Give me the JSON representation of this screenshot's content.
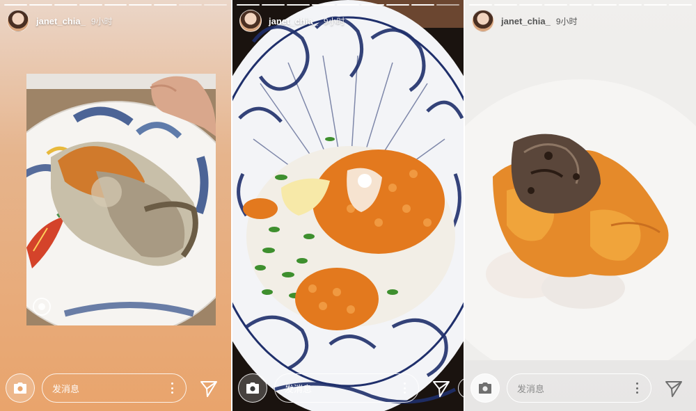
{
  "stories": [
    {
      "username": "janet_chia_",
      "time": "9小时",
      "message_placeholder": "发消息",
      "photo_icon": "camera-icon",
      "photo_label": "grilled oyster on patterned plate"
    },
    {
      "username": "janet_chia_",
      "time": "9小时",
      "message_placeholder": "发消息",
      "photo_icon": "camera-icon",
      "photo_label": "tobiko with scallion and grated garlic"
    },
    {
      "username": "janet_chia_",
      "time": "9小时",
      "message_placeholder": "发消息",
      "photo_icon": "camera-icon",
      "photo_label": "uni with black truffle on scallop"
    }
  ],
  "colors": {
    "panel1_bg_top": "#ebd6c8",
    "panel1_bg_bottom": "#e9a46c",
    "panel2_bg": "#1c1410",
    "panel3_bg": "#ebeae8",
    "text_white": "#ffffff",
    "text_gray": "#555555"
  }
}
